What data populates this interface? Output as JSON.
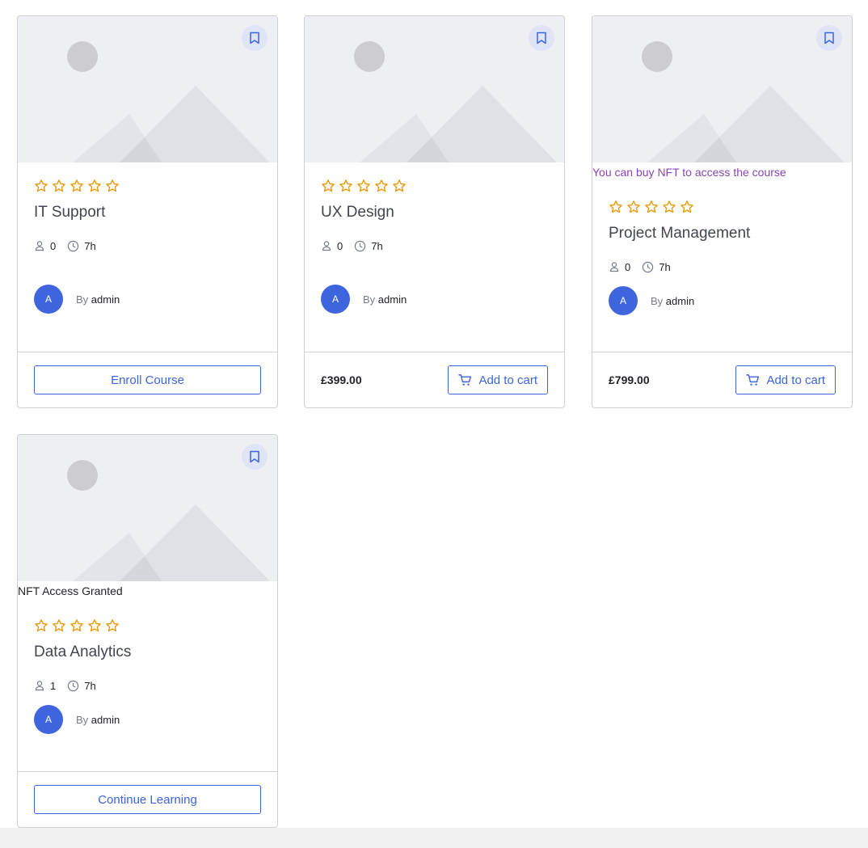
{
  "colors": {
    "accent": "#3e64de",
    "star": "#ed9700",
    "nft_notice": "#8a45b6",
    "border": "#cdcfd5"
  },
  "icons": {
    "bookmark": "bookmark-icon",
    "star": "star-outline-icon",
    "user": "user-icon",
    "clock": "clock-icon",
    "cart": "cart-icon"
  },
  "courses": [
    {
      "title": "IT Support",
      "rating_stars": 5,
      "enrolled": "0",
      "duration": "7h",
      "avatar_initial": "A",
      "by_label": "By",
      "author": "admin",
      "action_label": "Enroll Course"
    },
    {
      "title": "UX Design",
      "rating_stars": 5,
      "enrolled": "0",
      "duration": "7h",
      "avatar_initial": "A",
      "by_label": "By",
      "author": "admin",
      "price": "£399.00",
      "action_label": "Add to cart"
    },
    {
      "notice": "You can buy NFT to access the course",
      "title": "Project Management",
      "rating_stars": 5,
      "enrolled": "0",
      "duration": "7h",
      "avatar_initial": "A",
      "by_label": "By",
      "author": "admin",
      "price": "£799.00",
      "action_label": "Add to cart"
    },
    {
      "notice": "NFT Access Granted",
      "title": "Data Analytics",
      "rating_stars": 5,
      "enrolled": "1",
      "duration": "7h",
      "avatar_initial": "A",
      "by_label": "By",
      "author": "admin",
      "action_label": "Continue Learning"
    }
  ]
}
